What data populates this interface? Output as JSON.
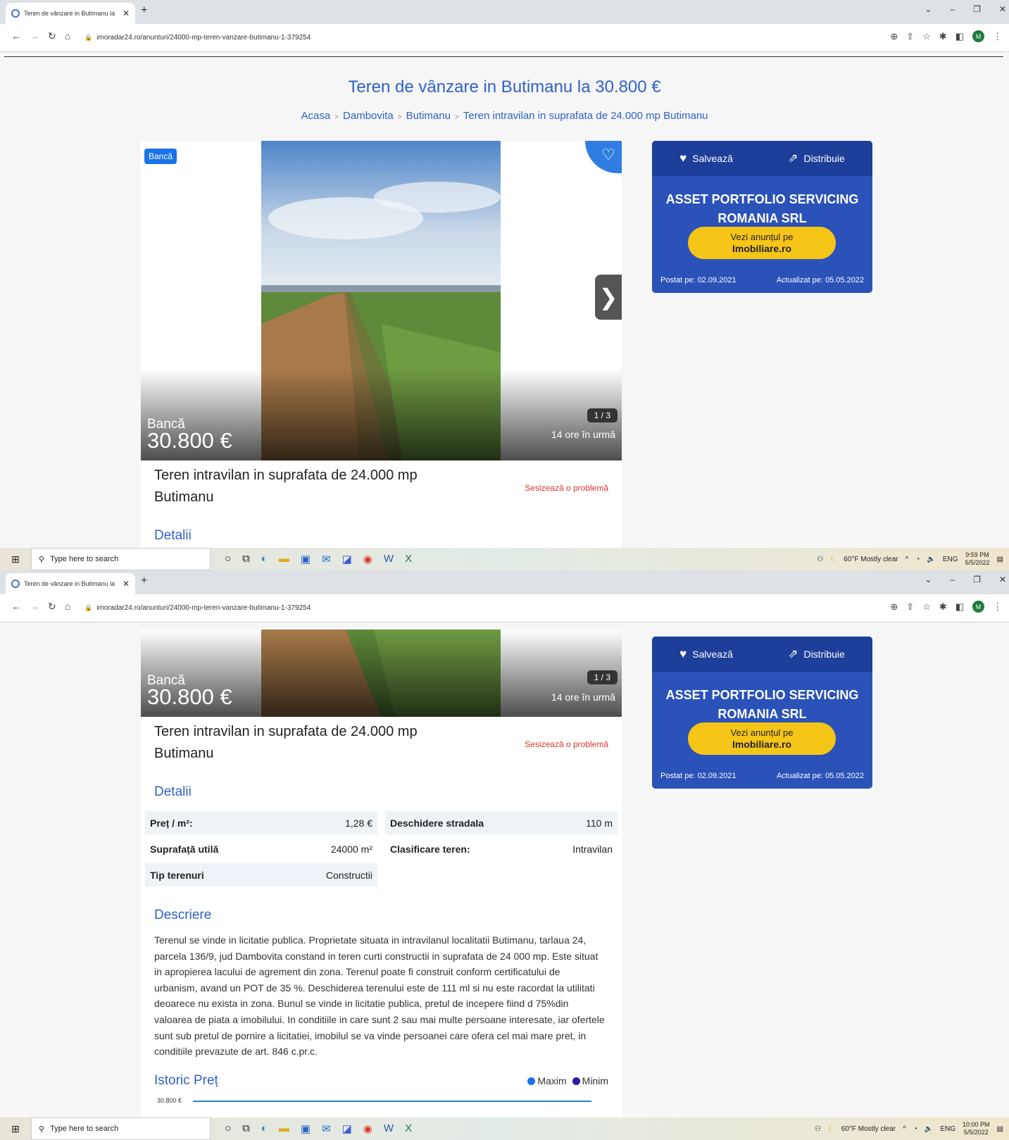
{
  "browser": {
    "tab_title": "Teren de vânzare in Butimanu la",
    "new_tab": "+",
    "url": "imoradar24.ro/anunturi/24000-mp-teren-vanzare-butimanu-1-379254",
    "avatar_letter": "M"
  },
  "page": {
    "heading": "Teren de vânzare in Butimanu la 30.800 €",
    "breadcrumbs": [
      "Acasa",
      "Dambovita",
      "Butimanu",
      "Teren intravilan in suprafata de 24.000 mp Butimanu"
    ],
    "badge": "Bancă",
    "overlay_type": "Bancă",
    "overlay_price": "30.800 €",
    "photo_counter": "1 / 3",
    "posted_ago": "14 ore în urmă",
    "listing_title": "Teren intravilan in suprafata de 24.000 mp Butimanu",
    "report_link": "Sesizează o problemă",
    "details_heading": "Detalii",
    "details": [
      {
        "label": "Preț / m²:",
        "value": "1,28 €"
      },
      {
        "label": "Deschidere stradala",
        "value": "110 m"
      },
      {
        "label": "Suprafață utilă",
        "value": "24000 m²"
      },
      {
        "label": "Clasificare teren:",
        "value": "Intravilan"
      },
      {
        "label": "Tip terenuri",
        "value": "Constructii"
      }
    ],
    "description_heading": "Descriere",
    "description": "Terenul se vinde in licitatie publica. Proprietate situata in intravilanul localitatii Butimanu, tarlaua 24, parcela 136/9, jud Dambovita constand in teren curti constructii in suprafata de 24 000 mp. Este situat in apropierea lacului de agrement din zona. Terenul poate fi construit conform certificatului de urbanism, avand un POT de 35 %. Deschiderea terenului este de 111 ml si nu este racordat la utilitati deoarece nu exista in zona. Bunul se vinde in licitatie publica, pretul de incepere fiind d 75%din valoarea de piata a imobilului. In conditiile in care sunt 2 sau mai multe persoane interesate, iar ofertele sunt sub pretul de pornire a licitatiei, imobilul se va vinde persoanei care ofera cel mai mare pret, in conditiile prevazute de art. 846 c.pr.c.",
    "price_history_heading": "Istoric Preț",
    "legend_max": "Maxim",
    "legend_min": "Minim",
    "price_history_label": "30.800 €",
    "colors": {
      "max": "#1a73e8",
      "min": "#2a1a9e"
    }
  },
  "sidebar": {
    "save_label": "Salvează",
    "share_label": "Distribuie",
    "company": "ASSET PORTFOLIO SERVICING ROMANIA SRL",
    "cta_line1": "Vezi anunțul pe",
    "cta_line2": "Imobiliare.ro",
    "posted": "Postat pe: 02.09.2021",
    "updated": "Actualizat pe: 05.05.2022"
  },
  "taskbar": {
    "search_placeholder": "Type here to search",
    "weather": "60°F  Mostly clear",
    "lang": "ENG",
    "time1": "9:59 PM",
    "time2": "10:00 PM",
    "date": "5/5/2022"
  }
}
